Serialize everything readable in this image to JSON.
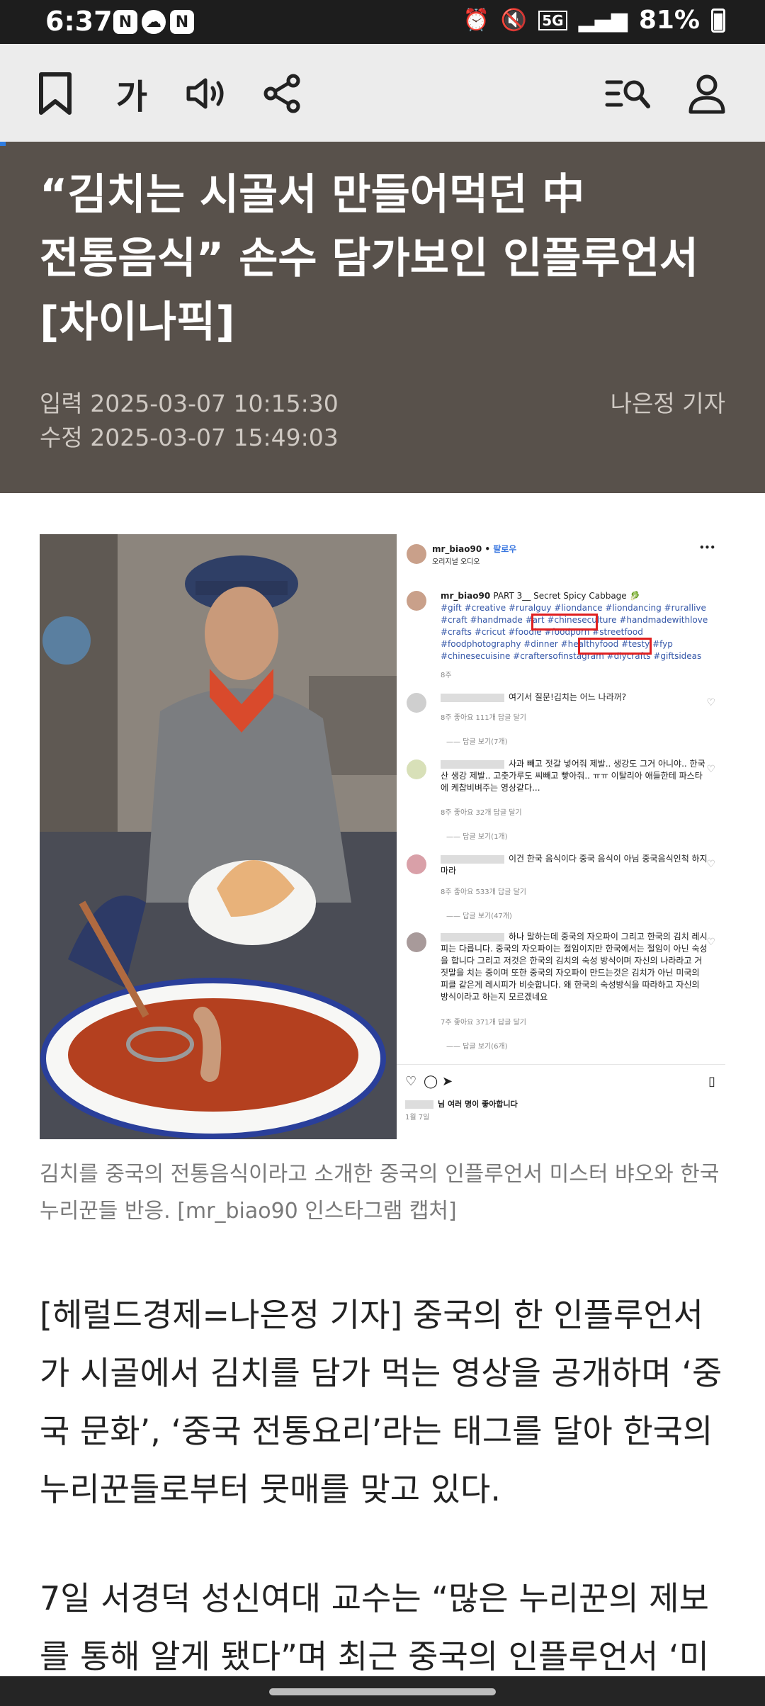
{
  "status_bar": {
    "time": "6:37",
    "notifications": [
      "N",
      "N"
    ],
    "network": "5G",
    "battery": "81%"
  },
  "toolbar": {
    "font_label": "가"
  },
  "article": {
    "title_line1": "“김치는 시골서 만들어먹던 中",
    "title_line2": "전통음식” 손수 담가보인 인플루언서",
    "title_line3": "[차이나픽]",
    "input_date": "입력 2025-03-07 10:15:30",
    "edit_date": "수정 2025-03-07 15:49:03",
    "reporter": "나은정 기자",
    "caption": "김치를 중국의 전통음식이라고 소개한 중국의 인플루언서 미스터 뱌오와 한국 누리꾼들 반응. [mr_biao90 인스타그램 캡처]",
    "paragraph1": "[헤럴드경제=나은정 기자] 중국의 한 인플루언서가 시골에서 김치를 담가 먹는 영상을 공개하며 ‘중국 문화’, ‘중국 전통요리’라는 태그를 달아 한국의 누리꾼들로부터 뭇매를 맞고 있다.",
    "paragraph2": "7일 서경덕 성신여대 교수는 “많은 누리꾼의 제보를 통해 알게 됐다”며 최근 중국의 인플루언서 ‘미"
  },
  "instagram": {
    "username": "mr_biao90",
    "follow": "팔로우",
    "audio": "오리지널 오디오",
    "caption_user": "mr_biao90",
    "caption_text": "PART 3__ Secret Spicy Cabbage",
    "tags": "#gift #creative #ruralguy #liondance #liondancing #rurallive #craft #handmade #art #chineseculture #handmadewithlove #crafts #cricut #foodie #foodporn #streetfood #foodphotography #dinner #healthyfood #testy #fyp #chinesecuisine #craftersofinstagram #diycrafts #giftsideas",
    "caption_age": "8주",
    "comments": [
      {
        "text": "여기서 질문!김치는 어느 나라꺼?",
        "meta": "8주   좋아요 111개   답글 달기",
        "replies": "답글 보기(7개)"
      },
      {
        "text": "사과 빼고 젓갈 넣어줘 제발.. 생강도 그거 아니야.. 한국산 생강 제발.. 고춧가루도 씨빼고 빻아줘.. ㅠㅠ 이탈리아 애들한테 파스타에 케찹비벼주는 영상같다...",
        "meta": "8주   좋아요 32개   답글 달기",
        "replies": "답글 보기(1개)"
      },
      {
        "text": "이건 한국 음식이다 중국 음식이 아님 중국음식인척 하지마라",
        "meta": "8주   좋아요 533개   답글 달기",
        "replies": "답글 보기(47개)"
      },
      {
        "text": "하나 말하는데 중국의 자오파이 그리고 한국의 김치 레시피는 다릅니다. 중국의 자오파이는 절임이지만 한국에서는 절임이 아닌 숙성을 합니다 그리고 저것은 한국의 김치의 숙성 방식이며 자신의 나라라고 거짓말을 치는 중이며 또한 중국의 자오파이 만드는것은 김치가 아닌 미국의 피클 같은게 레시피가 비슷합니다. 왜 한국의 숙성방식을 따라하고 자신의 방식이라고 하는지 모르겠네요",
        "meta": "7주   좋아요 371개   답글 달기",
        "replies": "답글 보기(6개)"
      }
    ],
    "likes": "님 여러 명이 좋아합니다",
    "date": "1월 7일"
  },
  "colors": {
    "header_bg": "#58514b",
    "highlight_box": "#e02020",
    "accent": "#2f7de1"
  }
}
